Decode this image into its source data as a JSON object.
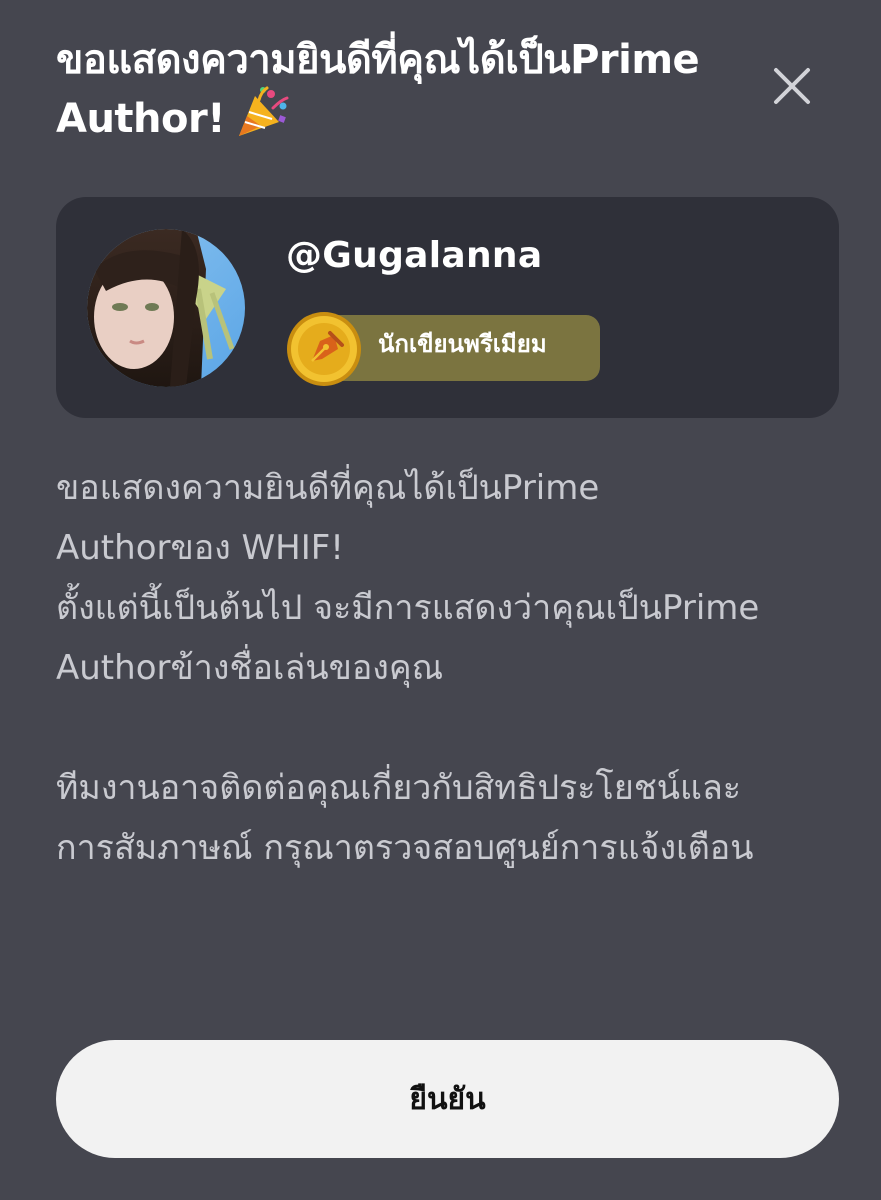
{
  "dialog": {
    "title": "ขอแสดงความยินดีที่คุณได้เป็นPrime Author!",
    "title_emoji": "party-popper-icon",
    "close_icon": "close-icon"
  },
  "profile": {
    "username": "@Gugalanna",
    "badge_label": "นักเขียนพรีเมียม",
    "badge_icon": "pen-nib-coin-icon"
  },
  "message": {
    "paragraph1_line1": "ขอแสดงความยินดีที่คุณได้เป็นPrime",
    "paragraph1_line2": "Authorของ WHIF!",
    "paragraph1_line3": "ตั้งแต่นี้เป็นต้นไป จะมีการแสดงว่าคุณเป็นPrime",
    "paragraph1_line4": "Authorข้างชื่อเล่นของคุณ",
    "paragraph2_line1": "ทีมงานอาจติดต่อคุณเกี่ยวกับสิทธิประโยชน์และ",
    "paragraph2_line2": "การสัมภาษณ์ กรุณาตรวจสอบศูนย์การแจ้งเตือน"
  },
  "actions": {
    "confirm_label": "ยืนยัน"
  },
  "colors": {
    "background": "#45464f",
    "card": "#2f3039",
    "badge": "#7b7440",
    "coin": "#e6b21f",
    "button": "#f2f2f2"
  }
}
